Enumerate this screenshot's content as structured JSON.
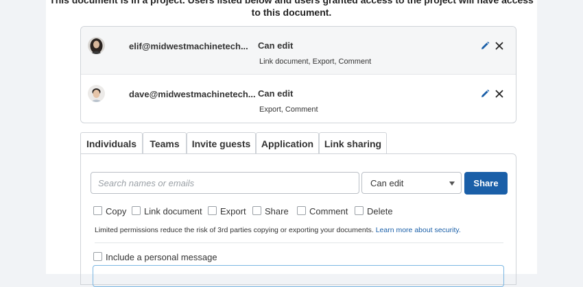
{
  "notice": {
    "line1": "This document is in a project. Users listed below and users granted access to the project will have access",
    "line2": "to this document."
  },
  "members": [
    {
      "email": "elif@midwestmachinetech...",
      "permission": "Can edit",
      "details": "Link document, Export, Comment"
    },
    {
      "email": "dave@midwestmachinetech...",
      "permission": "Can edit",
      "details": "Export, Comment"
    }
  ],
  "tabs": [
    "Individuals",
    "Teams",
    "Invite guests",
    "Application",
    "Link sharing"
  ],
  "invite": {
    "search_placeholder": "Search names or emails",
    "permission_selected": "Can edit",
    "share_label": "Share"
  },
  "permissions": [
    "Copy",
    "Link document",
    "Export",
    "Share",
    "Comment",
    "Delete"
  ],
  "hint": {
    "text": "Limited permissions reduce the risk of 3rd parties copying or exporting your documents. ",
    "link": "Learn more about security."
  },
  "personal_message_label": "Include a personal message",
  "colors": {
    "accent": "#1a5fa8",
    "focus_border": "#7ab6e2"
  }
}
